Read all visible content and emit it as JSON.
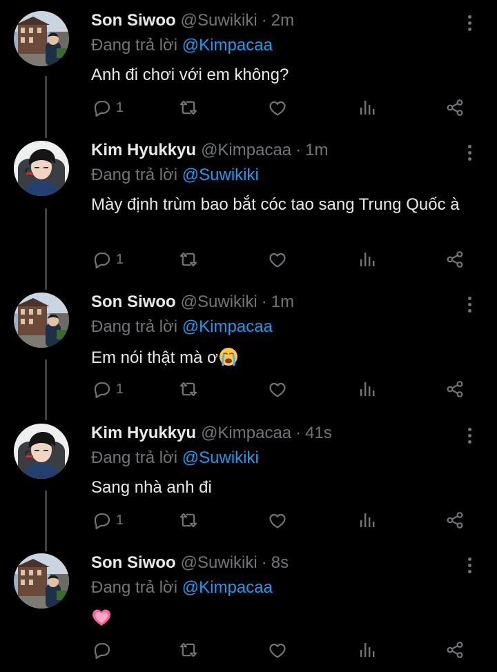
{
  "reply_prefix": "Đang trả lời",
  "tweets": [
    {
      "name": "Son Siwoo",
      "handle": "@Suwikiki",
      "sep": "·",
      "time": "2m",
      "reply_to": "@Kimpacaa",
      "text": "Anh đi chơi với em không?",
      "reply_count": "1"
    },
    {
      "name": "Kim Hyukkyu",
      "handle": "@Kimpacaa",
      "sep": "·",
      "time": "1m",
      "reply_to": "@Suwikiki",
      "text": "Mày định trùm bao bắt cóc tao sang Trung Quốc à",
      "reply_count": "1"
    },
    {
      "name": "Son Siwoo",
      "handle": "@Suwikiki",
      "sep": "·",
      "time": "1m",
      "reply_to": "@Kimpacaa",
      "text": "Em nói thật mà ơ",
      "emoji": "crying-face-emoji",
      "reply_count": "1"
    },
    {
      "name": "Kim Hyukkyu",
      "handle": "@Kimpacaa",
      "sep": "·",
      "time": "41s",
      "reply_to": "@Suwikiki",
      "text": "Sang nhà anh đi",
      "reply_count": "1"
    },
    {
      "name": "Son Siwoo",
      "handle": "@Suwikiki",
      "sep": "·",
      "time": "8s",
      "reply_to": "@Kimpacaa",
      "text": "",
      "emoji": "pink-heart-emoji",
      "reply_count": ""
    }
  ],
  "colors": {
    "background": "#000000",
    "text": "#e7e9ea",
    "secondary": "#71767b",
    "mention": "#1d9bf0",
    "thread_line": "#3e4144"
  },
  "icons": [
    "reply-icon",
    "retweet-icon",
    "like-icon",
    "views-icon",
    "share-icon",
    "more-options-icon"
  ]
}
